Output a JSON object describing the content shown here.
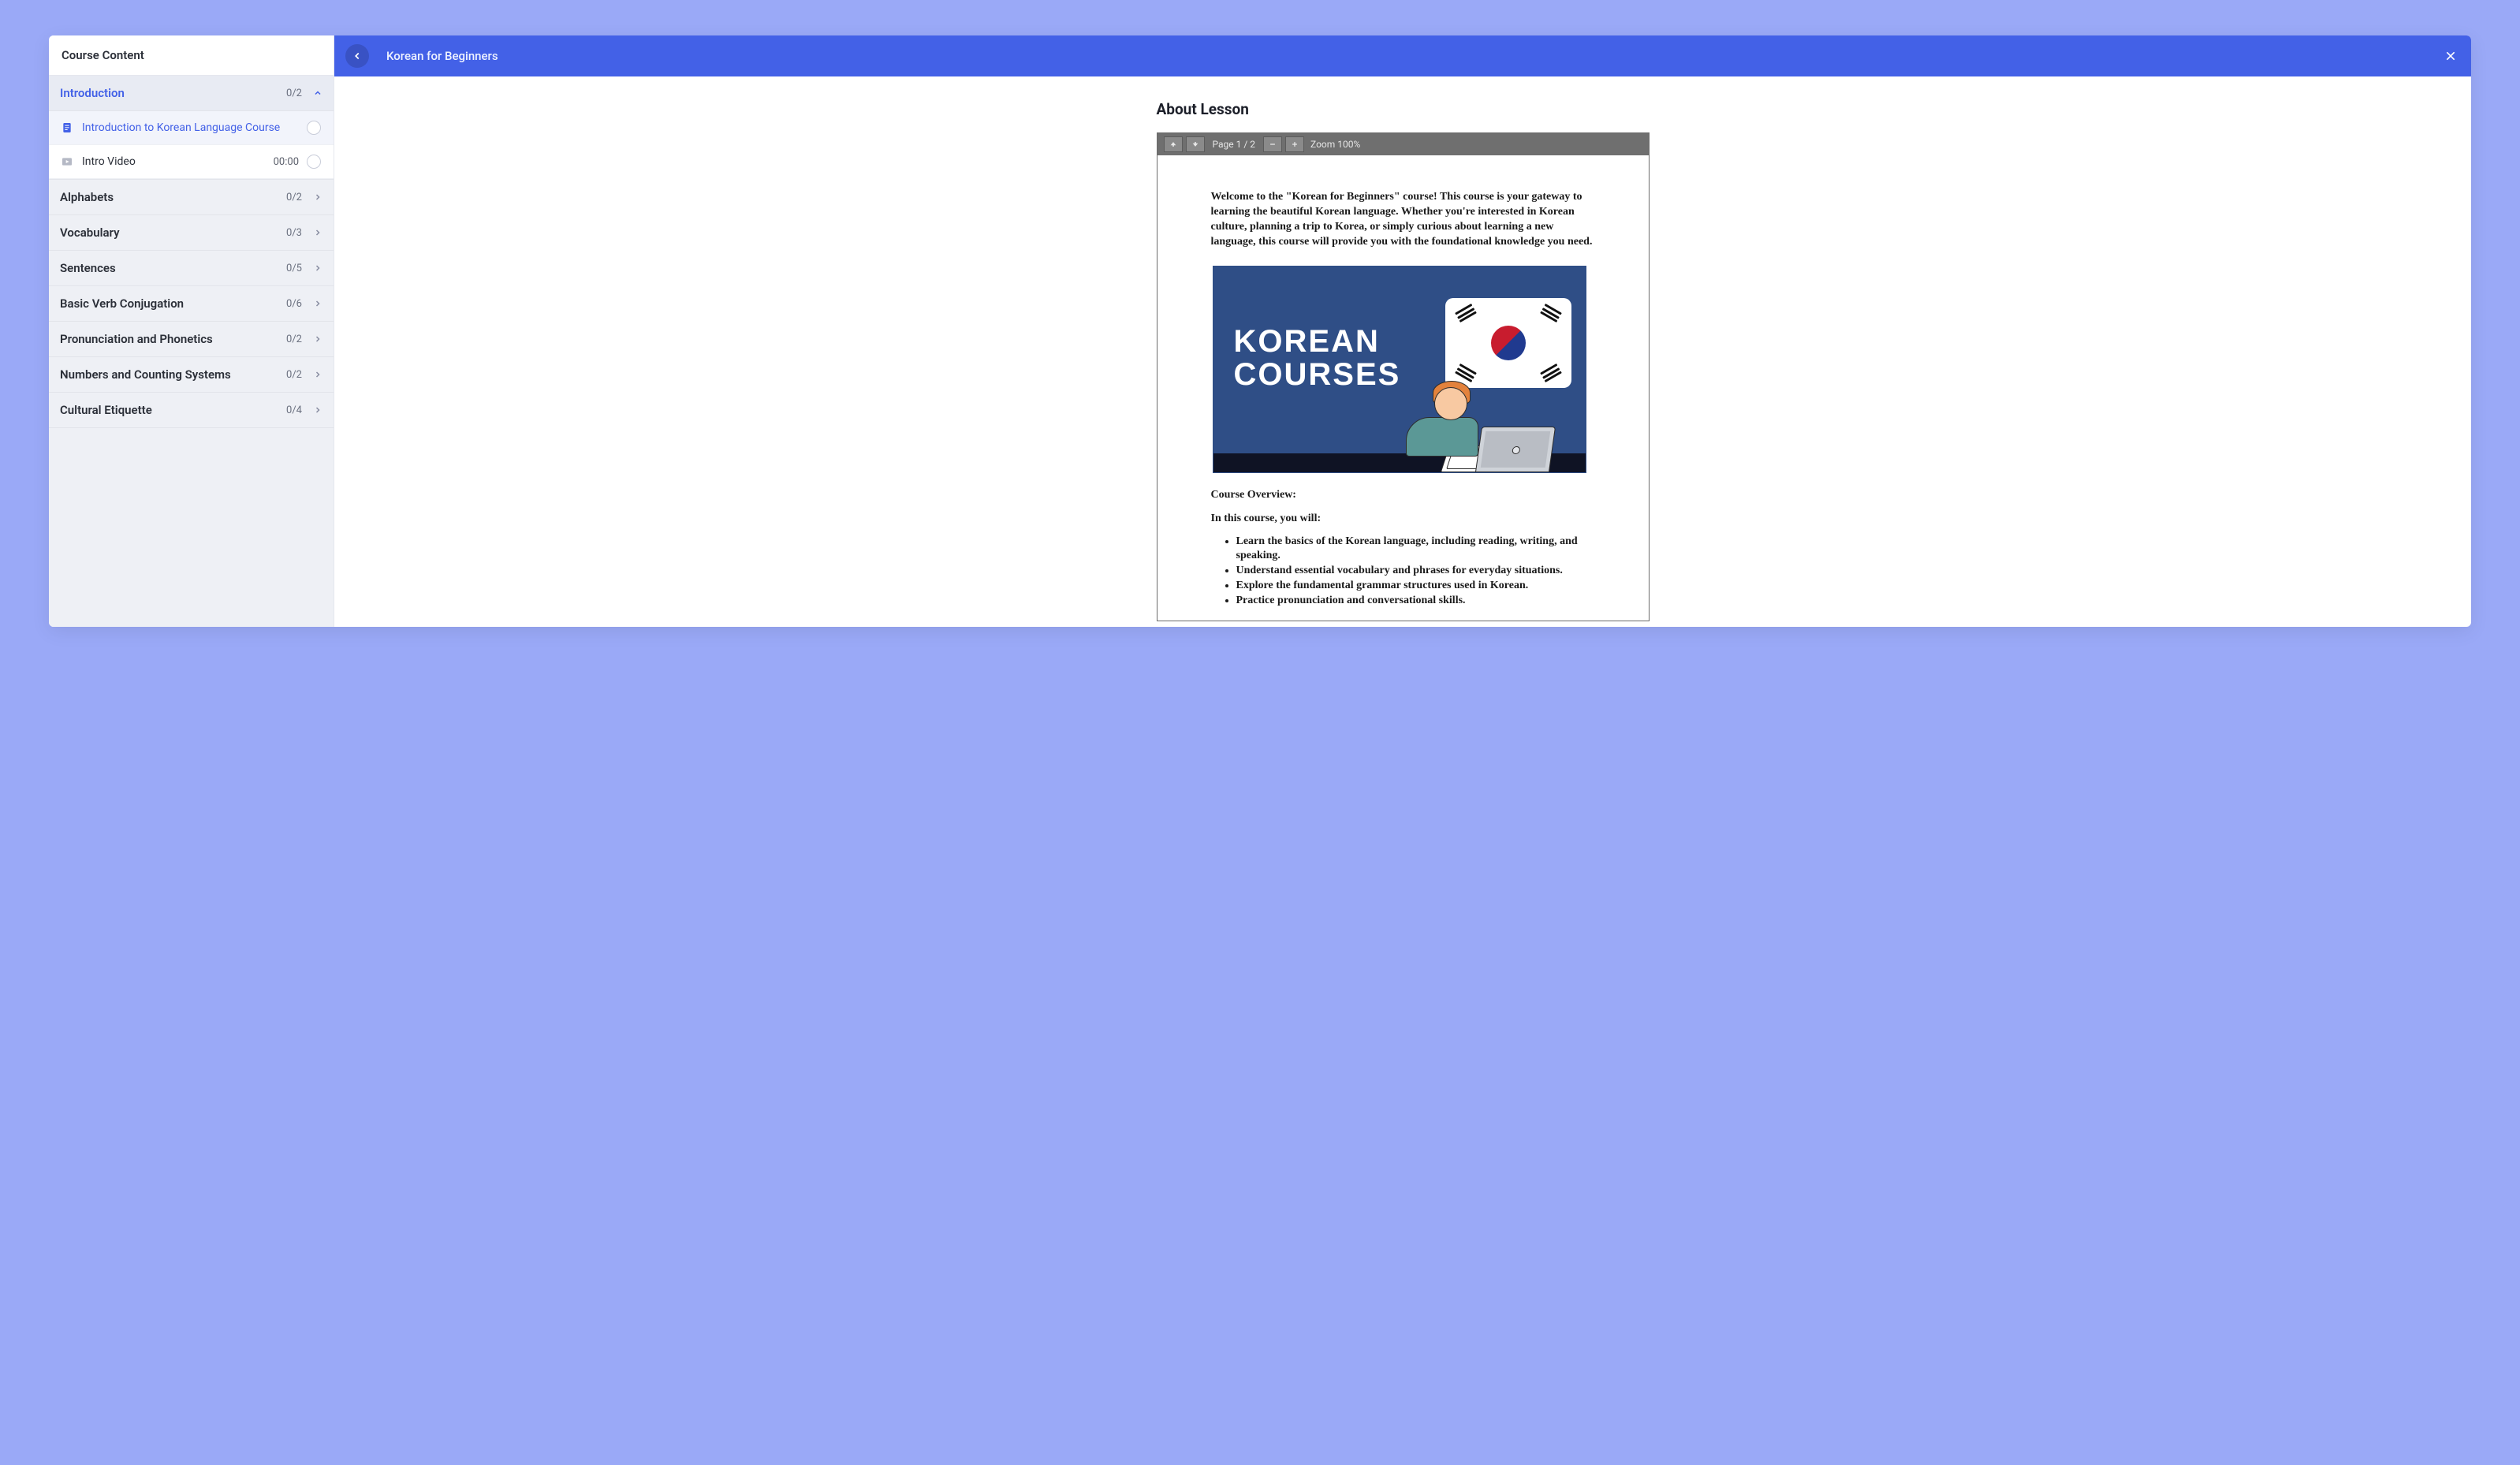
{
  "sidebar": {
    "header": "Course Content",
    "sections": [
      {
        "title": "Introduction",
        "count": "0/2"
      },
      {
        "title": "Alphabets",
        "count": "0/2"
      },
      {
        "title": "Vocabulary",
        "count": "0/3"
      },
      {
        "title": "Sentences",
        "count": "0/5"
      },
      {
        "title": "Basic Verb Conjugation",
        "count": "0/6"
      },
      {
        "title": "Pronunciation and Phonetics",
        "count": "0/2"
      },
      {
        "title": "Numbers and Counting Systems",
        "count": "0/2"
      },
      {
        "title": "Cultural Etiquette",
        "count": "0/4"
      }
    ],
    "intro_lessons": [
      {
        "title": "Introduction to Korean Language Course",
        "meta": ""
      },
      {
        "title": "Intro Video",
        "meta": "00:00"
      }
    ]
  },
  "header": {
    "title": "Korean for Beginners"
  },
  "main": {
    "heading": "About Lesson",
    "pdf_toolbar": {
      "page_label": "Page 1 / 2",
      "zoom_label": "Zoom 100%"
    },
    "document": {
      "intro_paragraph": "Welcome to the \"Korean for Beginners\" course! This course is your gateway to learning the beautiful Korean language. Whether you're interested in Korean culture, planning a trip to Korea, or simply curious about learning a new language, this course will provide you with the foundational knowledge you need.",
      "hero_line1": "KOREAN",
      "hero_line2": "COURSES",
      "overview_heading": "Course Overview:",
      "overview_lead": "In this course, you will:",
      "bullets": [
        "Learn the basics of the Korean language, including reading, writing, and speaking.",
        "Understand essential vocabulary and phrases for everyday situations.",
        "Explore the fundamental grammar structures used in Korean.",
        "Practice pronunciation and conversational skills."
      ]
    }
  }
}
